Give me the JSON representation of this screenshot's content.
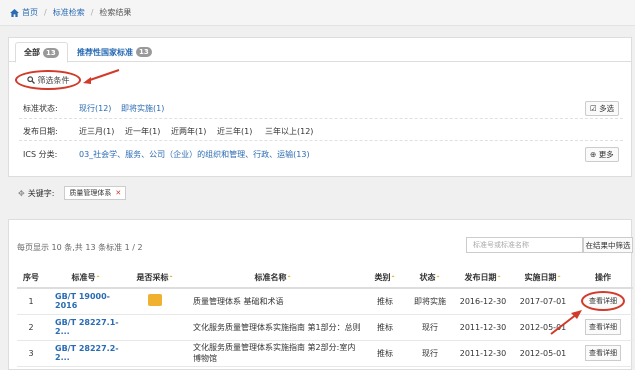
{
  "breadcrumb": {
    "home": "首页",
    "search": "标准检索",
    "current": "检索结果"
  },
  "tabs": [
    {
      "label": "全部",
      "count": "13"
    },
    {
      "label": "推荐性国家标准",
      "count": "13"
    }
  ],
  "filter": {
    "title": "筛选条件",
    "status_label": "标准状态:",
    "status_opts": [
      "现行(12)",
      "即将实施(1)"
    ],
    "multi_select": "多选",
    "date_label": "发布日期:",
    "date_opts": [
      "近三月(1)",
      "近一年(1)",
      "近两年(1)",
      "近三年(1)",
      "三年以上(12)"
    ],
    "ics_label": "ICS 分类:",
    "ics_value": "03_社会学、服务、公司（企业）的组织和管理、行政、运输(13)",
    "more": "更多"
  },
  "keyword": {
    "label": "关键字:",
    "tag": "质量管理体系"
  },
  "results": {
    "count_text": "每页显示 10 条,共 13 条标准  1 / 2",
    "search_placeholder": "标准号或标准名称",
    "search_button": "在结果中筛选",
    "columns": [
      "序号",
      "标准号",
      "是否采标",
      "标准名称",
      "类别",
      "状态",
      "发布日期",
      "实施日期",
      "操作"
    ],
    "rows": [
      {
        "no": "1",
        "code": "GB/T 19000-2016",
        "adopt": true,
        "name": "质量管理体系 基础和术语",
        "type": "推标",
        "status": "即将实施",
        "pub": "2016-12-30",
        "impl": "2017-07-01",
        "action": "查看详细"
      },
      {
        "no": "2",
        "code": "GB/T 28227.1-2...",
        "adopt": false,
        "name": "文化服务质量管理体系实施指南 第1部分：总则",
        "type": "推标",
        "status": "现行",
        "pub": "2011-12-30",
        "impl": "2012-05-01",
        "action": "查看详细"
      },
      {
        "no": "3",
        "code": "GB/T 28227.2-2...",
        "adopt": false,
        "name": "文化服务质量管理体系实施指南 第2部分:室内博物馆",
        "type": "推标",
        "status": "现行",
        "pub": "2011-12-30",
        "impl": "2012-05-01",
        "action": "查看详细"
      }
    ]
  },
  "colors": {
    "link": "#2a6bb3",
    "annotation": "#d23a2a",
    "badge": "#f0b030"
  }
}
